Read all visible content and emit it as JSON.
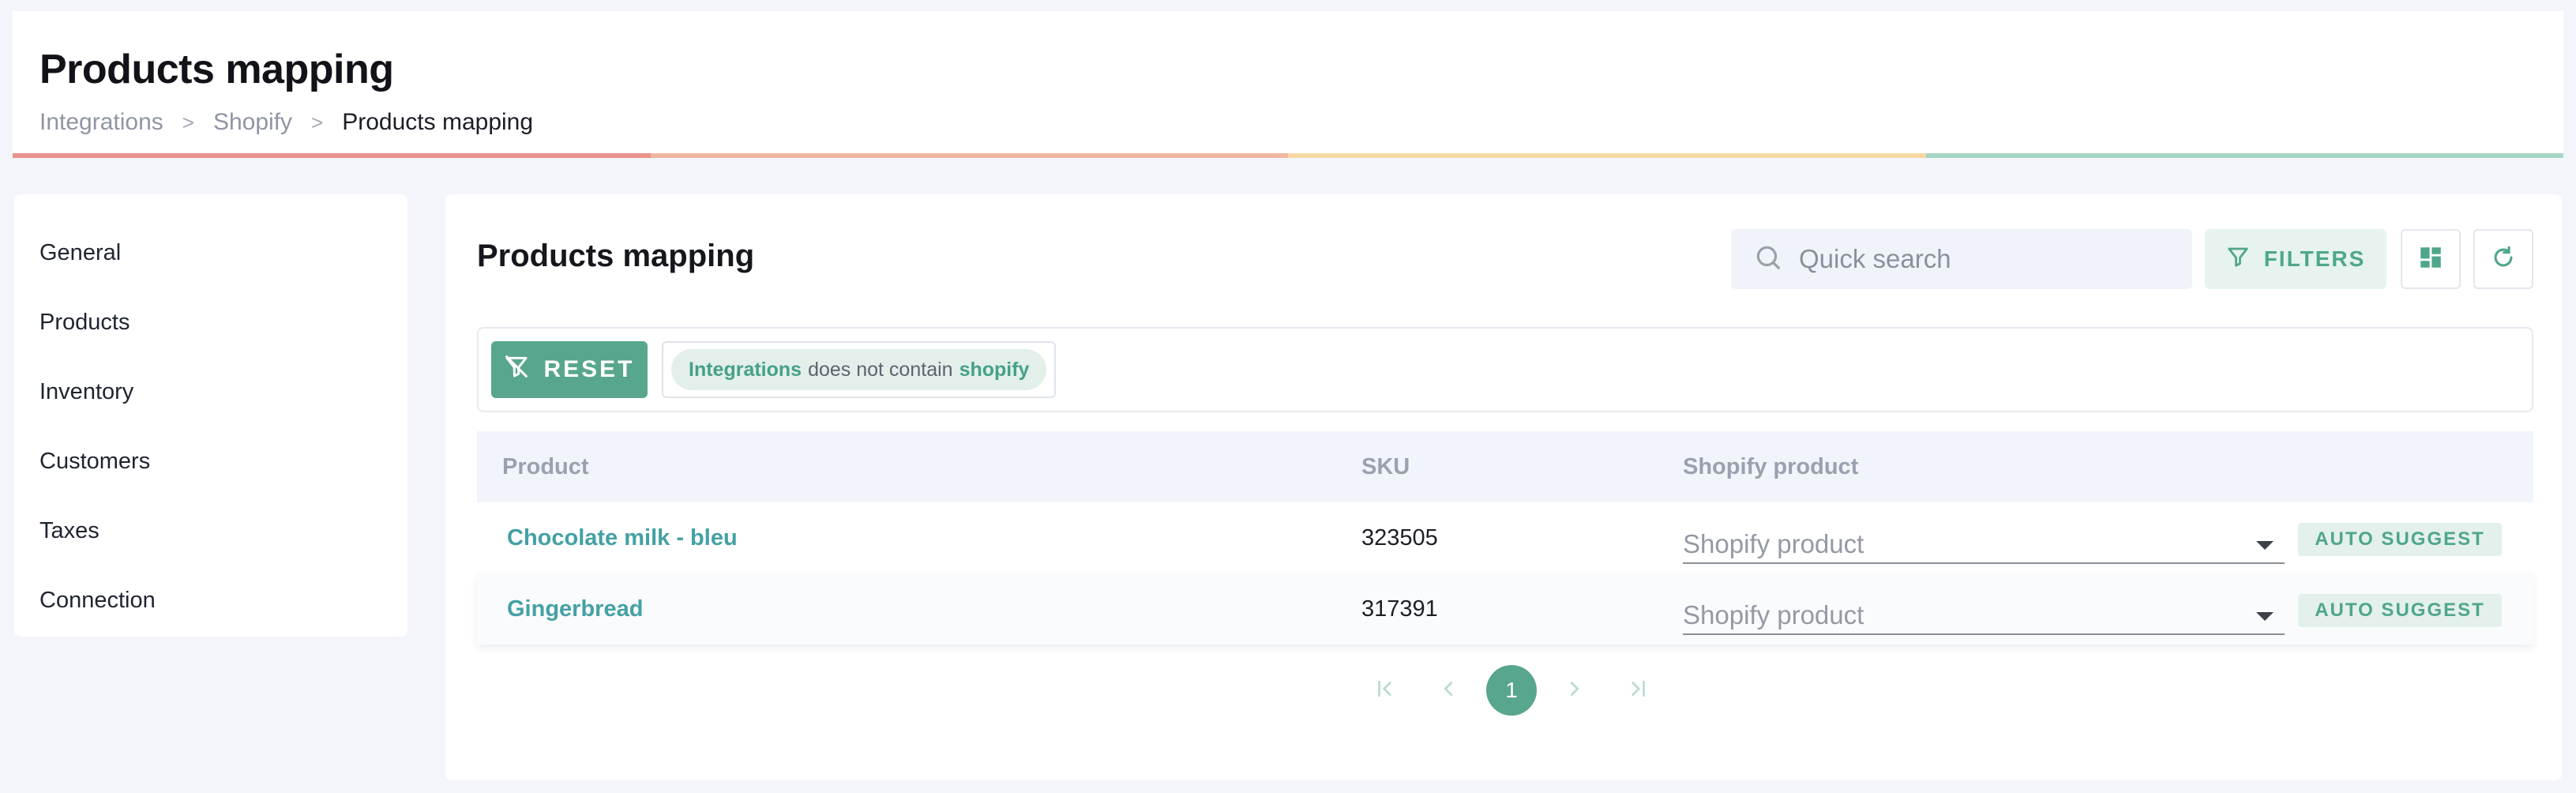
{
  "header": {
    "title": "Products mapping",
    "breadcrumb": {
      "item1": "Integrations",
      "item2": "Shopify",
      "current": "Products mapping",
      "separator": ">"
    },
    "strip_colors": [
      "#e8938b",
      "#f2b7a2",
      "#f6d9a3",
      "#a6d6c5"
    ]
  },
  "sidebar": {
    "items": [
      {
        "label": "General"
      },
      {
        "label": "Products"
      },
      {
        "label": "Inventory"
      },
      {
        "label": "Customers"
      },
      {
        "label": "Taxes"
      },
      {
        "label": "Connection"
      }
    ]
  },
  "main": {
    "title": "Products mapping",
    "search": {
      "placeholder": "Quick search",
      "value": ""
    },
    "filters_label": "FILTERS",
    "reset_label": "RESET",
    "active_filter": {
      "field": "Integrations",
      "operator": "does not contain",
      "value": "shopify"
    },
    "table": {
      "columns": {
        "product": "Product",
        "sku": "SKU",
        "shopify": "Shopify product"
      },
      "rows": [
        {
          "product": "Chocolate milk - bleu",
          "sku": "323505",
          "shopify_placeholder": "Shopify product",
          "action": "AUTO SUGGEST"
        },
        {
          "product": "Gingerbread",
          "sku": "317391",
          "shopify_placeholder": "Shopify product",
          "action": "AUTO SUGGEST"
        }
      ]
    },
    "pagination": {
      "current_page": "1"
    }
  },
  "colors": {
    "accent": "#57a68d",
    "link": "#44a1a4",
    "background": "#f3f5fb"
  }
}
